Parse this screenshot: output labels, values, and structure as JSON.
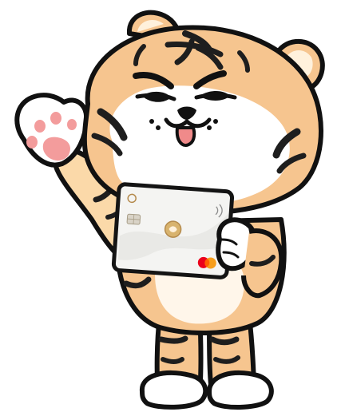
{
  "illustration": {
    "subject": "tiger-mascot",
    "colors": {
      "fur": "#F6C58F",
      "fur_light": "#FFF1DC",
      "fur_dark": "#EFA864",
      "stripe": "#1E1E1E",
      "outline": "#111111",
      "paw_pad": "#F39C9C",
      "tongue": "#F08A8A",
      "card": "#F4F4F2",
      "card_border": "#141414",
      "gold": "#B48A4C",
      "mc_red": "#EB001B",
      "mc_orange": "#F79E1B",
      "mc_mix": "#FF5F00"
    }
  },
  "card": {
    "bank_name": "",
    "brand_label": "",
    "network": "mastercard",
    "network_label": ""
  }
}
